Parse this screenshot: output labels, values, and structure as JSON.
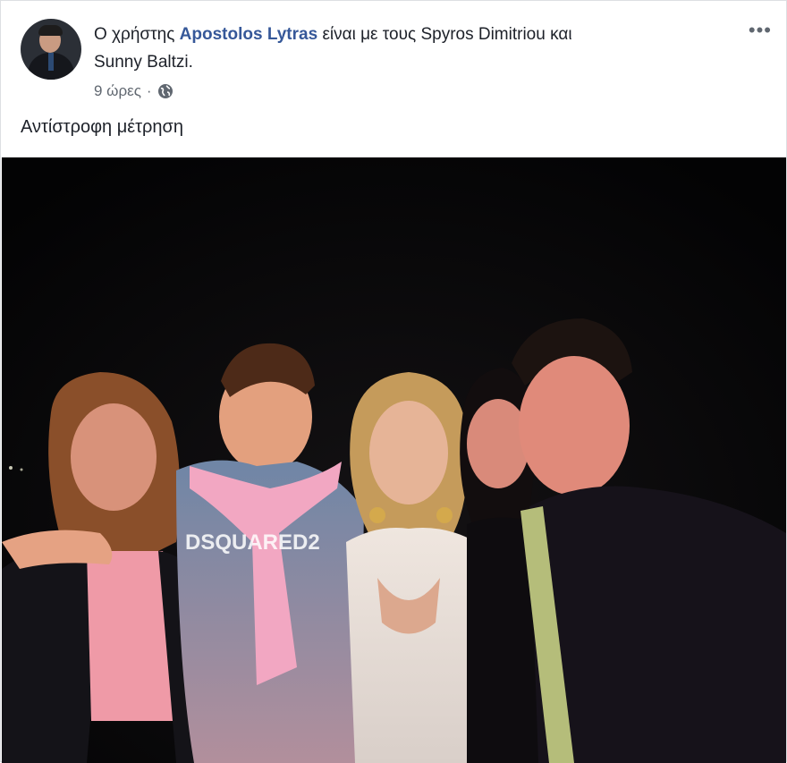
{
  "post": {
    "author_prefix": "Ο χρήστης",
    "author_name": "Apostolos Lytras",
    "with_text": "είναι με τους",
    "tagged_1": "Spyros Dimitriou",
    "conjunction": "και",
    "tagged_2": "Sunny Baltzi",
    "period": ".",
    "timestamp": "9 ώρες",
    "separator": "·",
    "caption": "Αντίστροφη μέτρηση",
    "more_icon": "more-horizontal-icon",
    "privacy_icon": "globe-icon"
  },
  "photo": {
    "shirt_text": "DSQUARED2"
  }
}
